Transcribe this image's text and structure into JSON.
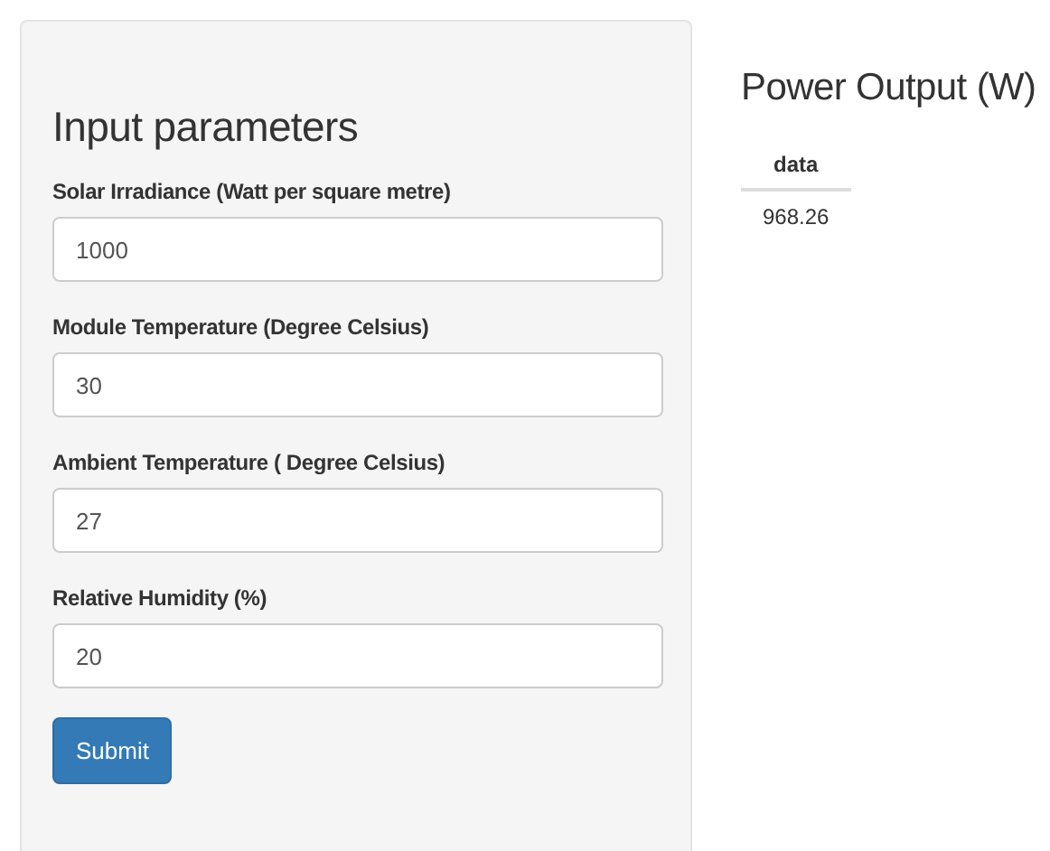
{
  "panel": {
    "title": "Input parameters",
    "fields": [
      {
        "label": "Solar Irradiance (Watt per square metre)",
        "value": "1000"
      },
      {
        "label": "Module Temperature (Degree Celsius)",
        "value": "30"
      },
      {
        "label": "Ambient Temperature ( Degree Celsius)",
        "value": "27"
      },
      {
        "label": "Relative Humidity (%)",
        "value": "20"
      }
    ],
    "button": "Submit"
  },
  "output": {
    "title": "Power Output (W)",
    "table": {
      "columns": [
        "data"
      ],
      "rows": [
        [
          "968.26"
        ]
      ]
    }
  }
}
